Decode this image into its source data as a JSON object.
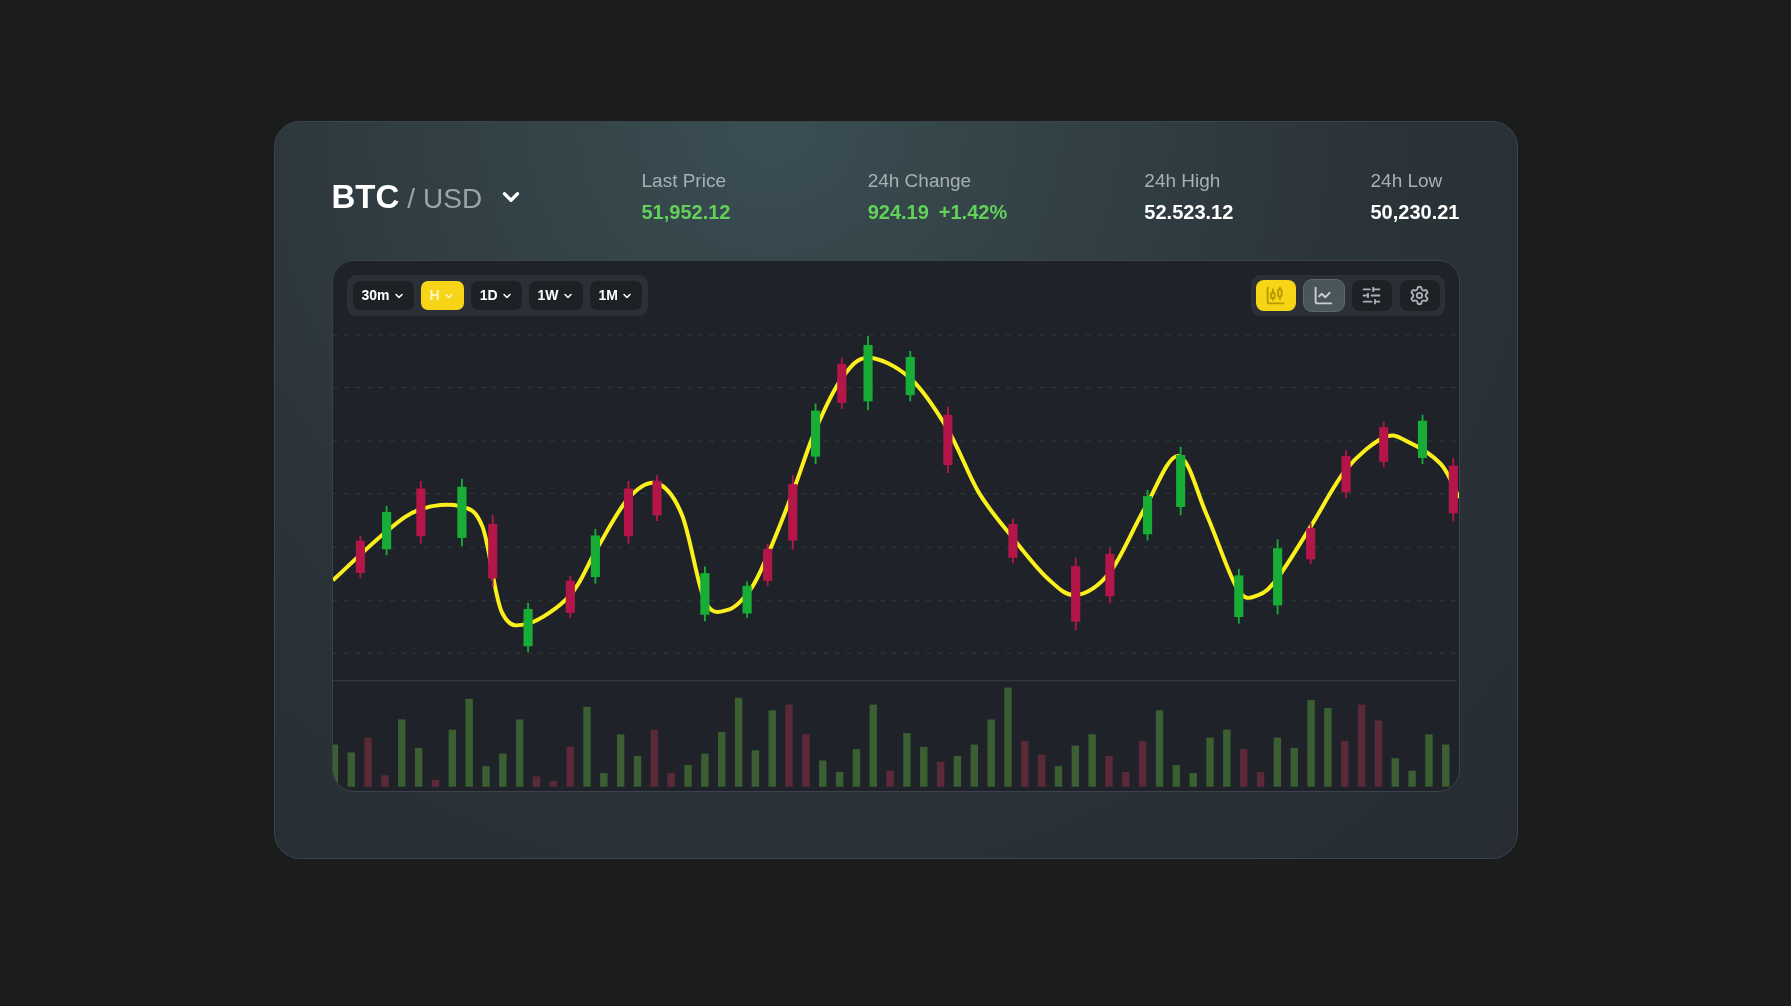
{
  "pair": {
    "base": "BTC",
    "separator": "/",
    "quote": "USD",
    "dropdown": true
  },
  "stats": [
    {
      "label": "Last Price",
      "values": [
        {
          "text": "51,952.12",
          "positive": true
        }
      ]
    },
    {
      "label": "24h Change",
      "values": [
        {
          "text": "924.19",
          "positive": true
        },
        {
          "text": "+1.42%",
          "positive": true
        }
      ]
    },
    {
      "label": "24h High",
      "values": [
        {
          "text": "52.523.12",
          "positive": false
        }
      ]
    },
    {
      "label": "24h Low",
      "values": [
        {
          "text": "50,230.21",
          "positive": false
        }
      ]
    }
  ],
  "timeframes": [
    {
      "label": "30m",
      "selected": false
    },
    {
      "label": "H",
      "selected": true
    },
    {
      "label": "1D",
      "selected": false
    },
    {
      "label": "1W",
      "selected": false
    },
    {
      "label": "1M",
      "selected": false
    }
  ],
  "tools": [
    {
      "kind": "candles",
      "selected": true,
      "highlighted": false
    },
    {
      "kind": "line",
      "selected": false,
      "highlighted": true
    },
    {
      "kind": "sliders",
      "selected": false,
      "highlighted": false
    },
    {
      "kind": "settings",
      "selected": false,
      "highlighted": false
    }
  ]
}
